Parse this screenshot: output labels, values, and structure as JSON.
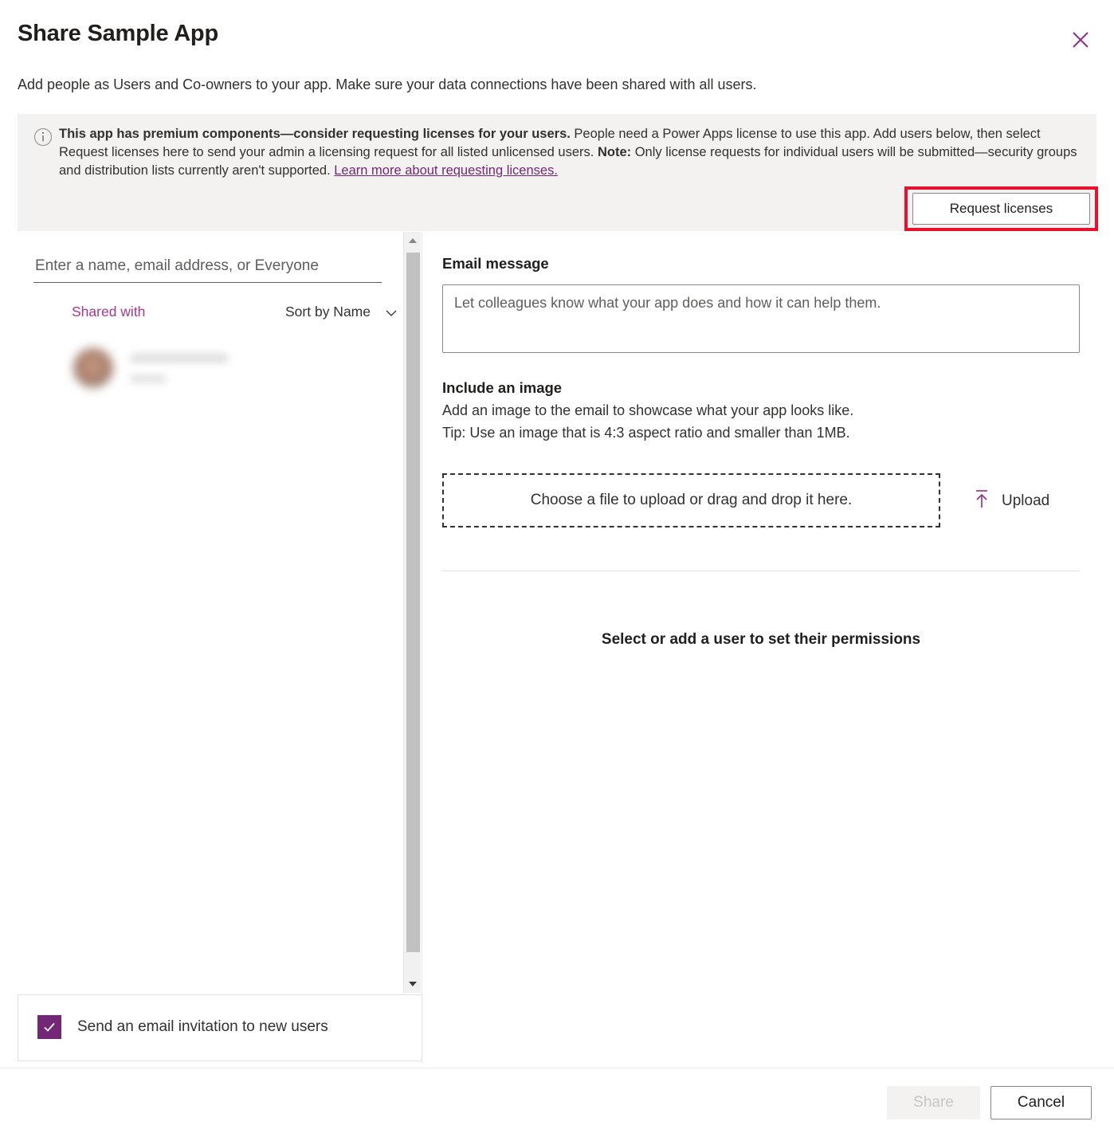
{
  "header": {
    "title": "Share Sample App",
    "subtitle": "Add people as Users and Co-owners to your app. Make sure your data connections have been shared with all users.",
    "close_icon": "close-icon"
  },
  "banner": {
    "info_icon": "info-icon",
    "bold_lead": "This app has premium components—consider requesting licenses for your users.",
    "body_1": " People need a Power Apps license to use this app. Add users below, then select Request licenses here to send your admin a licensing request for all listed unlicensed users. ",
    "note_label": "Note:",
    "body_2": " Only license requests for individual users will be submitted—security groups and distribution lists currently aren't supported. ",
    "link_text": "Learn more about requesting licenses.",
    "request_licenses_label": "Request licenses",
    "highlight_color": "#e8112d",
    "background": "#f3f2f1"
  },
  "left_panel": {
    "people_input_placeholder": "Enter a name, email address, or Everyone",
    "people_input_value": "",
    "shared_with_label": "Shared with",
    "sort_label": "Sort by Name",
    "sort_chevron_icon": "chevron-down-icon",
    "people": [
      {
        "name": "",
        "secondary": "",
        "avatar_icon": "avatar"
      }
    ],
    "invite_checkbox": {
      "label": "Send an email invitation to new users",
      "checked": true,
      "color": "#742774"
    },
    "scrollbar": {
      "up_icon": "scroll-up-arrow-icon",
      "down_icon": "scroll-down-arrow-icon"
    }
  },
  "right_panel": {
    "email_message_title": "Email message",
    "email_message_placeholder": "Let colleagues know what your app does and how it can help them.",
    "email_message_value": "",
    "include_image_title": "Include an image",
    "include_image_line1": "Add an image to the email to showcase what your app looks like.",
    "include_image_line2": "Tip: Use an image that is 4:3 aspect ratio and smaller than 1MB.",
    "dropzone_text": "Choose a file to upload or drag and drop it here.",
    "upload_label": "Upload",
    "upload_icon": "upload-icon",
    "permissions_empty_text": "Select or add a user to set their permissions"
  },
  "footer": {
    "share_label": "Share",
    "share_disabled": true,
    "cancel_label": "Cancel"
  },
  "theme": {
    "accent": "#742774",
    "link": "#742774",
    "shared_with_text": "#a4398f"
  }
}
